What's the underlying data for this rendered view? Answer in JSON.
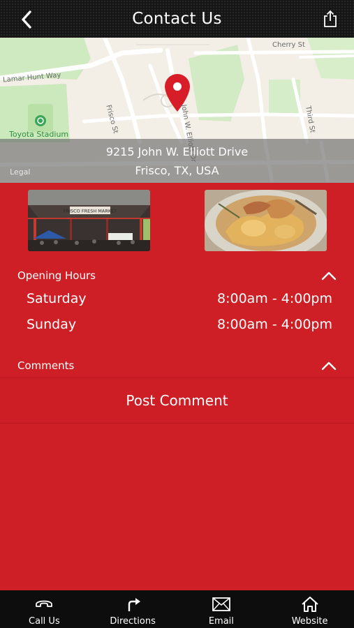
{
  "header": {
    "title": "Contact Us",
    "back_icon": "chevron-left-icon",
    "share_icon": "share-icon"
  },
  "map": {
    "labels": {
      "lamar_hunt_way": "Lamar Hunt Way",
      "cherry_st": "Cherry St",
      "frisco_st": "Frisco St",
      "elliott_dr": "John W. Elliott Dr",
      "third_st": "Third St",
      "toyota_stadium": "Toyota Stadium",
      "legal": "Legal"
    },
    "address_line1": "9215 John W. Elliott Drive",
    "address_line2": "Frisco, TX, USA",
    "pin_color": "#d71e28"
  },
  "photos": [
    {
      "name": "market-photo",
      "sign": "FRISCO FRESH MARKET"
    },
    {
      "name": "food-photo"
    }
  ],
  "opening_hours": {
    "heading": "Opening Hours",
    "rows": [
      {
        "day": "Saturday",
        "hours": "8:00am - 4:00pm"
      },
      {
        "day": "Sunday",
        "hours": "8:00am - 4:00pm"
      }
    ]
  },
  "comments": {
    "heading": "Comments",
    "post_button": "Post Comment"
  },
  "tabbar": {
    "items": [
      {
        "label": "Call Us",
        "icon": "phone-icon"
      },
      {
        "label": "Directions",
        "icon": "directions-icon"
      },
      {
        "label": "Email",
        "icon": "email-icon"
      },
      {
        "label": "Website",
        "icon": "home-icon"
      }
    ]
  },
  "colors": {
    "accent": "#cd1f25",
    "header_bg": "#151515",
    "tabbar_bg": "#0d0d0d"
  }
}
